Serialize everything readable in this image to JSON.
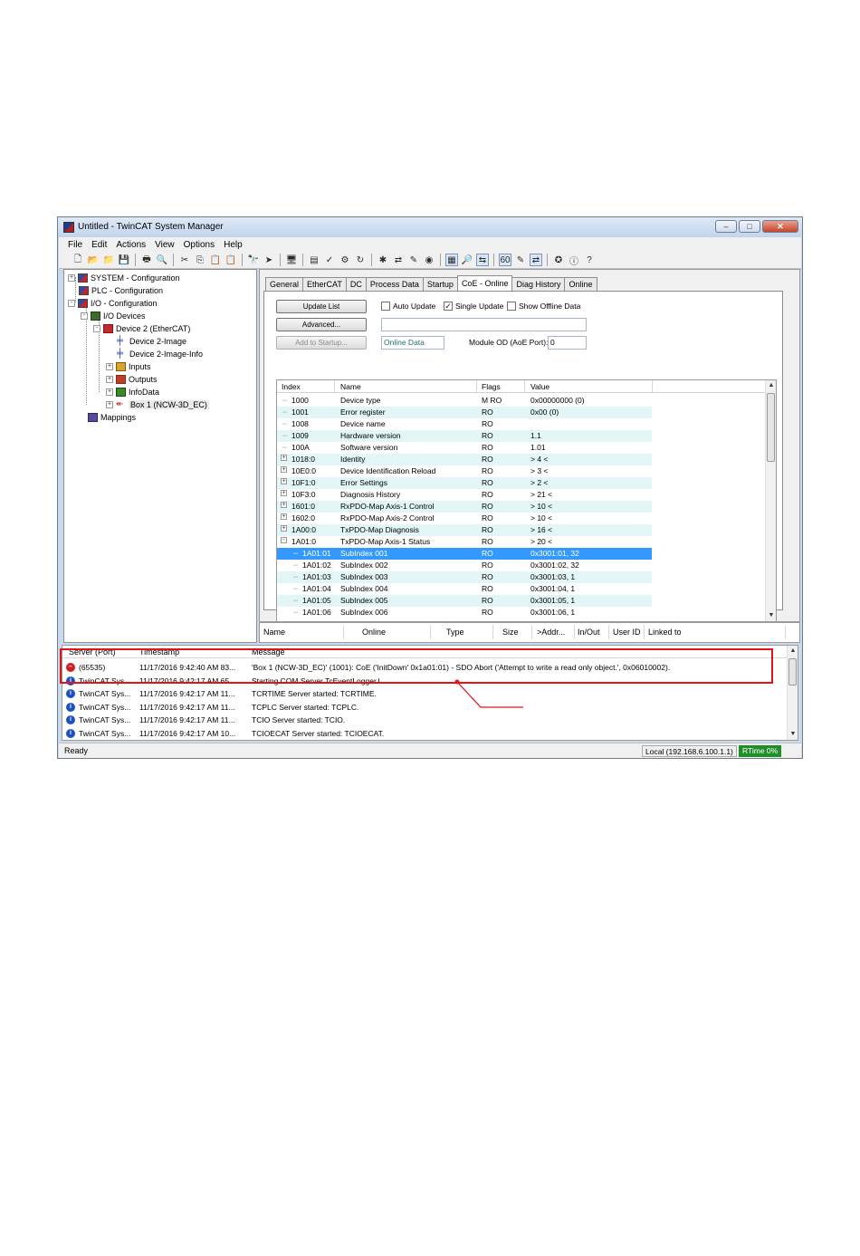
{
  "window": {
    "title": "Untitled - TwinCAT System Manager",
    "controls": {
      "minimize": "–",
      "maximize": "□",
      "close": "✕"
    }
  },
  "menu": [
    "File",
    "Edit",
    "Actions",
    "View",
    "Options",
    "Help"
  ],
  "toolbar": {
    "icons": [
      "new-file-icon",
      "open-icon",
      "open-folder-icon",
      "save-icon",
      "sep",
      "print-icon",
      "print-preview-icon",
      "sep",
      "cut-icon",
      "copy-icon",
      "paste-icon",
      "paste-with-links-icon",
      "sep",
      "find-icon",
      "find-next-icon",
      "sep",
      "target-system-icon",
      "sep",
      "generate-mappings-icon",
      "check-configuration-icon",
      "activate-configuration-icon",
      "restart-icon",
      "sep",
      "set-config-mode-icon",
      "load-devices-icon",
      "scan-boxes-icon",
      "toggle-freerun-icon",
      "sep",
      "show-tree-icon",
      "zoom-icon",
      "show-online-icon",
      "sep",
      "show-offline-icon",
      "show-variable-icon",
      "show-mappings-icon",
      "sep",
      "settings-icon",
      "info-icon",
      "help-icon"
    ],
    "glyphs": {
      "new-file-icon": "🗋",
      "open-icon": "📂",
      "open-folder-icon": "📁",
      "save-icon": "💾",
      "print-icon": "🖶",
      "print-preview-icon": "🔍",
      "cut-icon": "✂",
      "copy-icon": "⎘",
      "paste-icon": "📋",
      "paste-with-links-icon": "📋",
      "find-icon": "🔭",
      "find-next-icon": "➤",
      "target-system-icon": "🖥",
      "generate-mappings-icon": "▤",
      "check-configuration-icon": "✓",
      "activate-configuration-icon": "⚙",
      "restart-icon": "↻",
      "set-config-mode-icon": "✱",
      "load-devices-icon": "⇄",
      "scan-boxes-icon": "✎",
      "toggle-freerun-icon": "◉",
      "show-tree-icon": "▦",
      "zoom-icon": "🔎",
      "show-online-icon": "⇆",
      "show-offline-icon": "60",
      "show-variable-icon": "✎",
      "show-mappings-icon": "⇄",
      "settings-icon": "✪",
      "info-icon": "ⓘ",
      "help-icon": "?"
    },
    "pressed": [
      "show-tree-icon",
      "show-online-icon",
      "show-offline-icon",
      "show-mappings-icon"
    ]
  },
  "tree": {
    "system": "SYSTEM - Configuration",
    "plc": "PLC - Configuration",
    "io": "I/O - Configuration",
    "io_devices": "I/O Devices",
    "device2": "Device 2 (EtherCAT)",
    "device2_image": "Device 2-Image",
    "device2_image_info": "Device 2-Image-Info",
    "inputs": "Inputs",
    "outputs": "Outputs",
    "infodata": "InfoData",
    "box1": "Box 1 (NCW-3D_EC)",
    "mappings": "Mappings"
  },
  "tabs": [
    "General",
    "EtherCAT",
    "DC",
    "Process Data",
    "Startup",
    "CoE - Online",
    "Diag History",
    "Online"
  ],
  "active_tab": "CoE - Online",
  "coe": {
    "update_list": "Update List",
    "advanced": "Advanced...",
    "add_to_startup": "Add to Startup...",
    "auto_update": "Auto Update",
    "single_update": "Single Update",
    "show_offline": "Show Offline Data",
    "auto_update_checked": false,
    "single_update_checked": true,
    "show_offline_checked": false,
    "online_data": "Online Data",
    "module_od_label": "Module OD (AoE Port):",
    "module_od_value": "0",
    "check_mark": "✓"
  },
  "od_table": {
    "columns": [
      "Index",
      "Name",
      "Flags",
      "Value"
    ],
    "rows": [
      {
        "index": "1000",
        "name": "Device type",
        "flags": "M RO",
        "value": "0x00000000 (0)",
        "exp": "",
        "level": 0
      },
      {
        "index": "1001",
        "name": "Error register",
        "flags": "RO",
        "value": "0x00 (0)",
        "exp": "",
        "level": 0
      },
      {
        "index": "1008",
        "name": "Device name",
        "flags": "RO",
        "value": "",
        "exp": "",
        "level": 0
      },
      {
        "index": "1009",
        "name": "Hardware version",
        "flags": "RO",
        "value": "1.1",
        "exp": "",
        "level": 0
      },
      {
        "index": "100A",
        "name": "Software version",
        "flags": "RO",
        "value": "1.01",
        "exp": "",
        "level": 0
      },
      {
        "index": "1018:0",
        "name": "Identity",
        "flags": "RO",
        "value": "> 4 <",
        "exp": "+",
        "level": 0
      },
      {
        "index": "10E0:0",
        "name": "Device Identification Reload",
        "flags": "RO",
        "value": "> 3 <",
        "exp": "+",
        "level": 0
      },
      {
        "index": "10F1:0",
        "name": "Error Settings",
        "flags": "RO",
        "value": "> 2 <",
        "exp": "+",
        "level": 0
      },
      {
        "index": "10F3:0",
        "name": "Diagnosis History",
        "flags": "RO",
        "value": "> 21 <",
        "exp": "+",
        "level": 0
      },
      {
        "index": "1601:0",
        "name": "RxPDO-Map Axis-1 Control",
        "flags": "RO",
        "value": "> 10 <",
        "exp": "+",
        "level": 0
      },
      {
        "index": "1602:0",
        "name": "RxPDO-Map Axis-2 Control",
        "flags": "RO",
        "value": "> 10 <",
        "exp": "+",
        "level": 0
      },
      {
        "index": "1A00:0",
        "name": "TxPDO-Map Diagnosis",
        "flags": "RO",
        "value": "> 16 <",
        "exp": "+",
        "level": 0
      },
      {
        "index": "1A01:0",
        "name": "TxPDO-Map Axis-1 Status",
        "flags": "RO",
        "value": "> 20 <",
        "exp": "-",
        "level": 0
      },
      {
        "index": "1A01:01",
        "name": "SubIndex 001",
        "flags": "RO",
        "value": "0x3001:01, 32",
        "exp": "",
        "level": 1,
        "selected": true
      },
      {
        "index": "1A01:02",
        "name": "SubIndex 002",
        "flags": "RO",
        "value": "0x3001:02, 32",
        "exp": "",
        "level": 1
      },
      {
        "index": "1A01:03",
        "name": "SubIndex 003",
        "flags": "RO",
        "value": "0x3001:03, 1",
        "exp": "",
        "level": 1
      },
      {
        "index": "1A01:04",
        "name": "SubIndex 004",
        "flags": "RO",
        "value": "0x3001:04, 1",
        "exp": "",
        "level": 1
      },
      {
        "index": "1A01:05",
        "name": "SubIndex 005",
        "flags": "RO",
        "value": "0x3001:05, 1",
        "exp": "",
        "level": 1
      },
      {
        "index": "1A01:06",
        "name": "SubIndex 006",
        "flags": "RO",
        "value": "0x3001:06, 1",
        "exp": "",
        "level": 1
      }
    ]
  },
  "var_table": {
    "columns": [
      "Name",
      "Online",
      "Type",
      "Size",
      ">Addr...",
      "In/Out",
      "User ID",
      "Linked to"
    ]
  },
  "log": {
    "columns": [
      "Server (Port)",
      "Timestamp",
      "Message"
    ],
    "rows": [
      {
        "kind": "err",
        "server": "(65535)",
        "timestamp": "11/17/2016 9:42:40 AM 83...",
        "message": "'Box 1 (NCW-3D_EC)' (1001): CoE ('InitDown' 0x1a01:01) - SDO Abort ('Attempt to write a read only object.', 0x06010002)."
      },
      {
        "kind": "inf",
        "server": "TwinCAT Sys...",
        "timestamp": "11/17/2016 9:42:17 AM 65...",
        "message": "Starting COM Server TcEventLogger.l"
      },
      {
        "kind": "inf",
        "server": "TwinCAT Sys...",
        "timestamp": "11/17/2016 9:42:17 AM 11...",
        "message": "TCRTIME Server started: TCRTIME."
      },
      {
        "kind": "inf",
        "server": "TwinCAT Sys...",
        "timestamp": "11/17/2016 9:42:17 AM 11...",
        "message": "TCPLC Server started: TCPLC."
      },
      {
        "kind": "inf",
        "server": "TwinCAT Sys...",
        "timestamp": "11/17/2016 9:42:17 AM 11...",
        "message": "TCIO Server started: TCIO."
      },
      {
        "kind": "inf",
        "server": "TwinCAT Sys...",
        "timestamp": "11/17/2016 9:42:17 AM 10...",
        "message": "TCIOECAT Server started: TCIOECAT."
      }
    ]
  },
  "status": {
    "ready": "Ready",
    "local": "Local (192.168.6.100.1.1)",
    "rtime": "RTime 0%"
  },
  "colors": {
    "highlight": "#e0141a",
    "selection": "#3399ff",
    "alt_row": "#e2f6f8"
  }
}
